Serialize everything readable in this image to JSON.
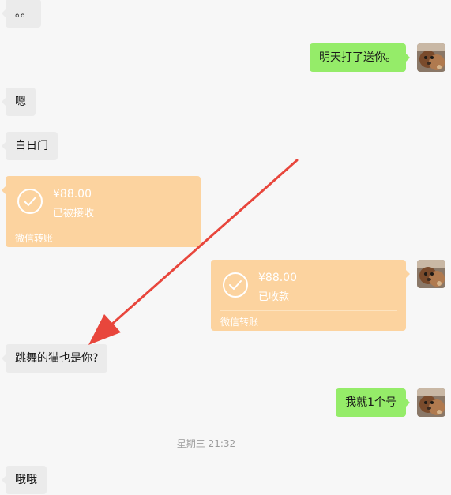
{
  "messages": {
    "m1": "。。",
    "m2": "明天打了送你。",
    "m3": "嗯",
    "m4": "白日门",
    "m5": "跳舞的猫也是你?",
    "m6": "我就1个号",
    "m7": "哦哦"
  },
  "transfer_left": {
    "amount": "¥88.00",
    "status": "已被接收",
    "label": "微信转账"
  },
  "transfer_right": {
    "amount": "¥88.00",
    "status": "已收款",
    "label": "微信转账"
  },
  "timestamp": "星期三 21:32",
  "colors": {
    "background": "#f7f7f7",
    "left_bubble": "#ebebeb",
    "right_bubble": "#95ec69",
    "transfer_card": "#fcd39f",
    "annotation_arrow": "#e8463c"
  },
  "icons": {
    "transfer_check": "check-circle-icon",
    "annotation": "arrow-icon"
  }
}
